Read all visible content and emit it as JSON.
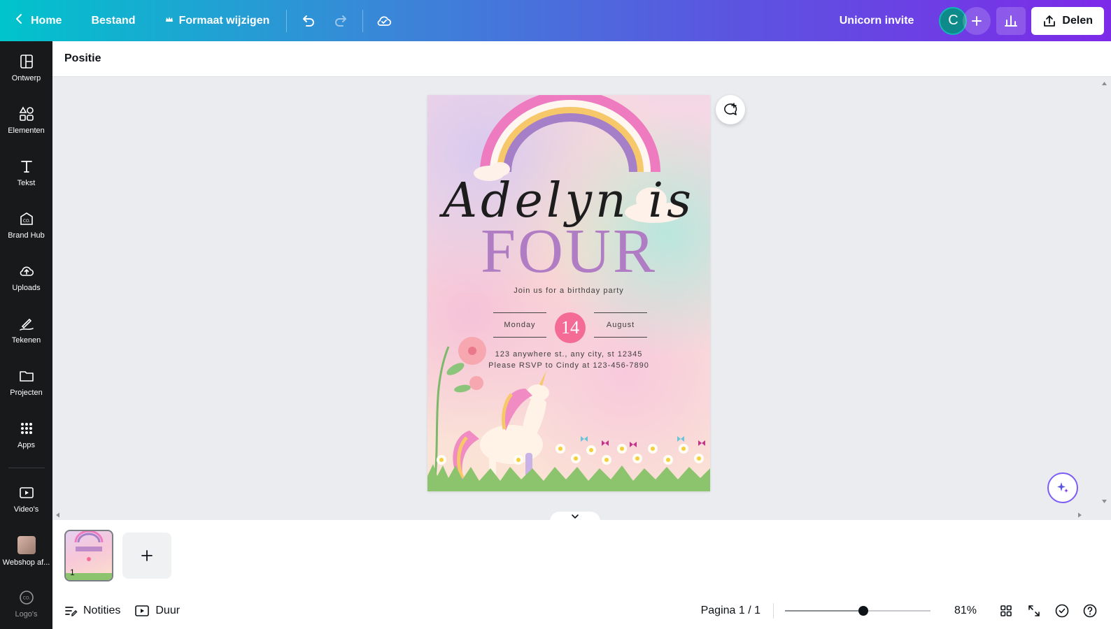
{
  "topbar": {
    "home_label": "Home",
    "file_label": "Bestand",
    "resize_label": "Formaat wijzigen",
    "design_title": "Unicorn invite",
    "avatar_initial": "C",
    "share_label": "Delen"
  },
  "sidebar": {
    "items": [
      {
        "label": "Ontwerp",
        "icon": "layout-icon"
      },
      {
        "label": "Elementen",
        "icon": "shapes-icon"
      },
      {
        "label": "Tekst",
        "icon": "text-icon"
      },
      {
        "label": "Brand Hub",
        "icon": "brand-icon"
      },
      {
        "label": "Uploads",
        "icon": "cloud-upload-icon"
      },
      {
        "label": "Tekenen",
        "icon": "draw-icon"
      },
      {
        "label": "Projecten",
        "icon": "folder-icon"
      },
      {
        "label": "Apps",
        "icon": "apps-grid-icon"
      },
      {
        "label": "Video's",
        "icon": "video-icon"
      },
      {
        "label": "Webshop af...",
        "icon": "webshop-thumbnail"
      },
      {
        "label": "Logo's",
        "icon": "logo-icon"
      }
    ]
  },
  "context_bar": {
    "position_label": "Positie"
  },
  "invitation": {
    "script_line": "Adelyn is",
    "big_line": "FOUR",
    "subtitle": "Join us for a birthday party",
    "day": "Monday",
    "date_number": "14",
    "month": "August",
    "address": "123 anywhere st., any city, st 12345",
    "rsvp": "Please RSVP to Cindy at 123-456-7890"
  },
  "pages": {
    "current_page_number": "1"
  },
  "bottombar": {
    "notes_label": "Notities",
    "duration_label": "Duur",
    "page_indicator": "Pagina 1 / 1",
    "zoom_label": "81%",
    "zoom_fraction": 0.54
  },
  "colors": {
    "accent_purple": "#7d2ae8",
    "accent_teal": "#00c4cc",
    "date_circle": "#f46b96",
    "four_text": "#b07dc4"
  }
}
